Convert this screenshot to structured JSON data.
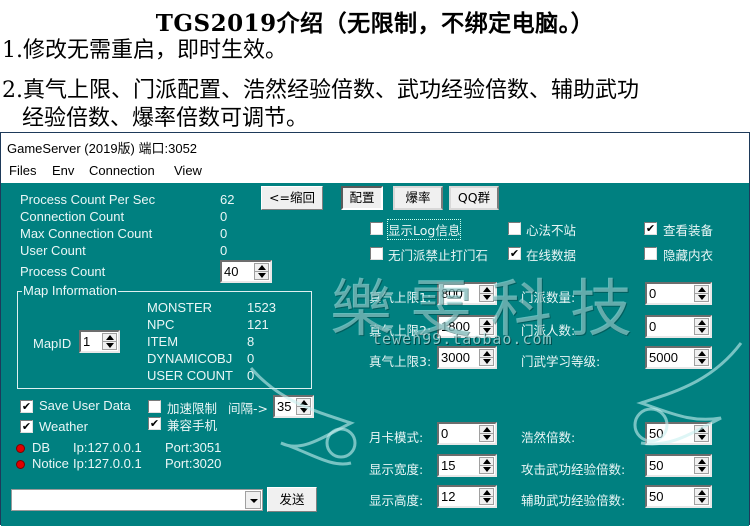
{
  "header": {
    "title": "TGS2019介绍（无限制，不绑定电脑。）",
    "line1": "1.修改无需重启，即时生效。",
    "line2": "2.真气上限、门派配置、浩然经验倍数、武功经验倍数、辅助武功",
    "line3": "经验倍数、爆率倍数可调节。"
  },
  "window": {
    "title": "GameServer (2019版) 端口:3052",
    "menu": [
      "Files",
      "Env",
      "Connection",
      "View"
    ]
  },
  "stats": [
    {
      "label": "Process Count Per Sec",
      "value": "62"
    },
    {
      "label": "Connection Count",
      "value": "0"
    },
    {
      "label": "Max Connection Count",
      "value": "0"
    },
    {
      "label": "User Count",
      "value": "0"
    }
  ],
  "process_count": {
    "label": "Process Count",
    "value": "40"
  },
  "collapse_button": "<=缩回",
  "tabs": [
    {
      "label": "配置",
      "active": true
    },
    {
      "label": "爆率",
      "active": false
    },
    {
      "label": "QQ群",
      "active": false
    }
  ],
  "map_info": {
    "legend": "Map Information",
    "mapid_label": "MapID",
    "mapid_value": "1",
    "rows": [
      {
        "label": "MONSTER",
        "value": "1523"
      },
      {
        "label": "NPC",
        "value": "121"
      },
      {
        "label": "ITEM",
        "value": "8"
      },
      {
        "label": "DYNAMICOBJ",
        "value": "0"
      },
      {
        "label": "USER COUNT",
        "value": "0"
      }
    ]
  },
  "options_left": {
    "save_user_data": {
      "label": "Save User Data",
      "checked": true
    },
    "weather": {
      "label": "Weather",
      "checked": true
    },
    "speed_limit": {
      "label": "加速限制",
      "checked": false
    },
    "mobile_compat": {
      "label": "兼容手机",
      "checked": true
    },
    "interval_label": "间隔->",
    "interval_value": "35"
  },
  "connections": [
    {
      "name": "DB",
      "ip": "Ip:127.0.0.1",
      "port": "Port:3051",
      "status_color": "#e00000"
    },
    {
      "name": "Notice",
      "ip": "Ip:127.0.0.1",
      "port": "Port:3020",
      "status_color": "#e00000"
    }
  ],
  "command": {
    "value": "",
    "send_label": "发送"
  },
  "config_checkboxes": [
    {
      "label": "显示Log信息",
      "checked": false
    },
    {
      "label": "心法不站",
      "checked": false
    },
    {
      "label": "查看装备",
      "checked": true
    },
    {
      "label": "无门派禁止打门石",
      "checked": false
    },
    {
      "label": "在线数据",
      "checked": true
    },
    {
      "label": "隐藏内衣",
      "checked": false
    }
  ],
  "config_fields_left": [
    {
      "label": "真气上限1:",
      "value": "800"
    },
    {
      "label": "真气上限2:",
      "value": "1800"
    },
    {
      "label": "真气上限3:",
      "value": "3000"
    },
    {
      "label": "月卡模式:",
      "value": "0"
    },
    {
      "label": "显示宽度:",
      "value": "15"
    },
    {
      "label": "显示高度:",
      "value": "12"
    }
  ],
  "config_fields_right": [
    {
      "label": "门派数量:",
      "value": "0"
    },
    {
      "label": "门派人数:",
      "value": "0"
    },
    {
      "label": "门武学习等级:",
      "value": "5000"
    },
    {
      "label": "浩然倍数:",
      "value": "50"
    },
    {
      "label": "攻击武功经验倍数:",
      "value": "50"
    },
    {
      "label": "辅助武功经验倍数:",
      "value": "50"
    }
  ],
  "watermark": {
    "text": "樂雯科技",
    "url": "tewen99.taobao.com"
  },
  "colors": {
    "client_bg": "#008080",
    "led": "#e00000"
  }
}
